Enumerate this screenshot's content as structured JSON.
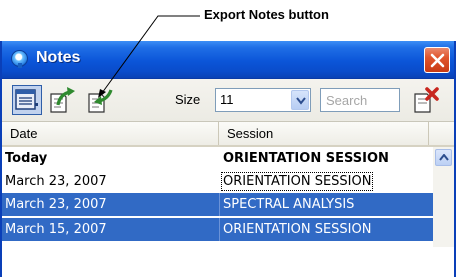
{
  "callout": {
    "label": "Export Notes button"
  },
  "window": {
    "title": "Notes"
  },
  "toolbar": {
    "size_label": "Size",
    "size_value": "11",
    "search_placeholder": "Search"
  },
  "columns": {
    "date": "Date",
    "session": "Session"
  },
  "rows": [
    {
      "date": "Today",
      "session": "ORIENTATION SESSION"
    },
    {
      "date": "March 23, 2007",
      "session": "ORIENTATION SESSION"
    },
    {
      "date": "March 23, 2007",
      "session": "SPECTRAL ANALYSIS"
    },
    {
      "date": "March 15, 2007",
      "session": "ORIENTATION SESSION"
    }
  ],
  "colors": {
    "titlebar": "#0b55d8",
    "selection": "#316ac5",
    "close_button": "#e0552d",
    "export_arrow": "#2f8a2f"
  },
  "icons": {
    "app": "notes-app-icon",
    "close": "close-icon",
    "view_toggle": "notes-view-icon",
    "export": "export-notes-icon",
    "import": "import-notes-icon",
    "dropdown": "chevron-down-icon",
    "delete": "delete-note-icon",
    "scroll": "scroll-up-icon"
  }
}
